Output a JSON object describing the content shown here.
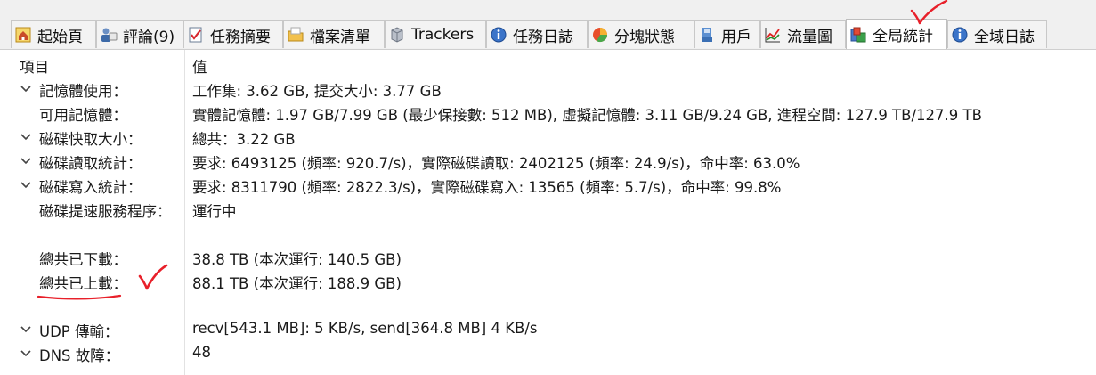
{
  "tabs": [
    {
      "label": "起始頁",
      "icon": "home-icon"
    },
    {
      "label": "評論(9)",
      "icon": "comments-icon"
    },
    {
      "label": "任務摘要",
      "icon": "checklist-icon"
    },
    {
      "label": "檔案清單",
      "icon": "folder-icon"
    },
    {
      "label": "Trackers",
      "icon": "server-icon"
    },
    {
      "label": "任務日誌",
      "icon": "info-icon"
    },
    {
      "label": "分塊狀態",
      "icon": "pie-chart-icon"
    },
    {
      "label": "用戶",
      "icon": "user-icon"
    },
    {
      "label": "流量圖",
      "icon": "line-chart-icon"
    },
    {
      "label": "全局統計",
      "icon": "stats-icon",
      "active": true
    },
    {
      "label": "全域日誌",
      "icon": "info-icon"
    }
  ],
  "table": {
    "header": {
      "col1": "項目",
      "col2": "值"
    },
    "rows": [
      {
        "name": "記憶體使用：",
        "value": "工作集: 3.62 GB, 提交大小: 3.77 GB",
        "expander": true
      },
      {
        "name": "可用記憶體：",
        "value": "實體記憶體: 1.97 GB/7.99 GB (最少保接數: 512 MB), 虛擬記憶體: 3.11 GB/9.24 GB, 進程空間: 127.9 TB/127.9 TB",
        "expander": false
      },
      {
        "name": "磁碟快取大小：",
        "value": "總共：3.22 GB",
        "expander": true
      },
      {
        "name": "磁碟讀取統計：",
        "value": "要求: 6493125 (頻率: 920.7/s)，實際磁碟讀取: 2402125 (頻率: 24.9/s)，命中率: 63.0%",
        "expander": true
      },
      {
        "name": "磁碟寫入統計：",
        "value": "要求: 8311790 (頻率: 2822.3/s)，實際磁碟寫入: 13565 (頻率: 5.7/s)，命中率: 99.8%",
        "expander": true
      },
      {
        "name": "磁碟提速服務程序：",
        "value": "運行中",
        "expander": false
      },
      {
        "name": "",
        "value": "",
        "expander": false
      },
      {
        "name": "總共已下載：",
        "value": "38.8 TB (本次運行: 140.5 GB)",
        "expander": false
      },
      {
        "name": "總共已上載：",
        "value": "88.1 TB (本次運行: 188.9 GB)",
        "expander": false
      },
      {
        "name": "",
        "value": "",
        "expander": false
      },
      {
        "name": "UDP 傳輸：",
        "value": "recv[543.1 MB]: 5 KB/s, send[364.8 MB] 4 KB/s",
        "expander": true
      },
      {
        "name": "DNS 故障：",
        "value": "48",
        "expander": true
      }
    ]
  },
  "colors": {
    "annotation": "#e8202a"
  }
}
